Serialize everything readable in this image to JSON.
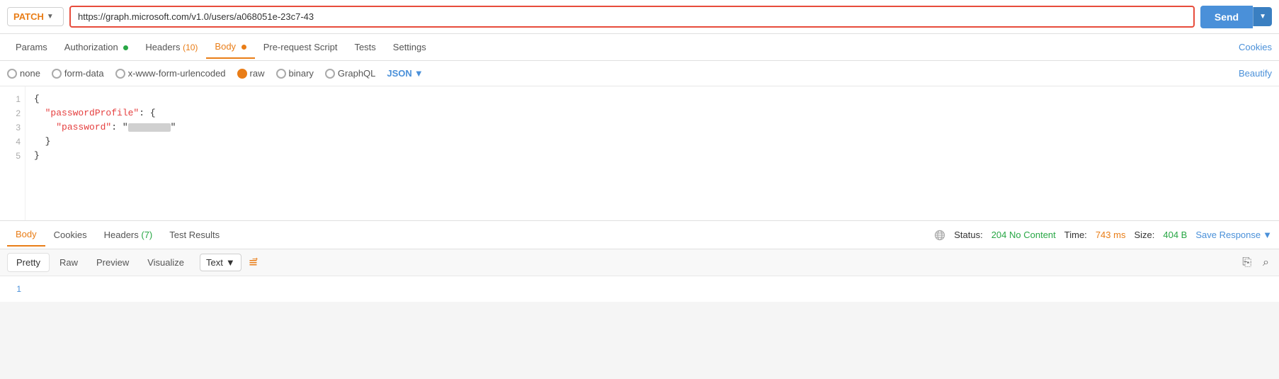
{
  "topbar": {
    "method": "PATCH",
    "url": "https://graph.microsoft.com/v1.0/users/a068051e-23c7-43",
    "send_label": "Send"
  },
  "request_tabs": [
    {
      "id": "params",
      "label": "Params",
      "active": false,
      "dot": null,
      "count": null
    },
    {
      "id": "authorization",
      "label": "Authorization",
      "active": false,
      "dot": "green",
      "count": null
    },
    {
      "id": "headers",
      "label": "Headers",
      "active": false,
      "dot": null,
      "count": "(10)"
    },
    {
      "id": "body",
      "label": "Body",
      "active": true,
      "dot": "orange",
      "count": null
    },
    {
      "id": "prerequest",
      "label": "Pre-request Script",
      "active": false,
      "dot": null,
      "count": null
    },
    {
      "id": "tests",
      "label": "Tests",
      "active": false,
      "dot": null,
      "count": null
    },
    {
      "id": "settings",
      "label": "Settings",
      "active": false,
      "dot": null,
      "count": null
    }
  ],
  "cookies_link": "Cookies",
  "body_types": [
    {
      "id": "none",
      "label": "none",
      "selected": false
    },
    {
      "id": "form-data",
      "label": "form-data",
      "selected": false
    },
    {
      "id": "x-www-form-urlencoded",
      "label": "x-www-form-urlencoded",
      "selected": false
    },
    {
      "id": "raw",
      "label": "raw",
      "selected": true
    },
    {
      "id": "binary",
      "label": "binary",
      "selected": false
    },
    {
      "id": "graphql",
      "label": "GraphQL",
      "selected": false
    }
  ],
  "json_type_label": "JSON",
  "beautify_label": "Beautify",
  "code_lines": [
    {
      "num": 1,
      "content": "{"
    },
    {
      "num": 2,
      "content": "  \"passwordProfile\": {"
    },
    {
      "num": 3,
      "content": "    \"password\": \"[REDACTED]\""
    },
    {
      "num": 4,
      "content": "  }"
    },
    {
      "num": 5,
      "content": "}"
    }
  ],
  "response_tabs": [
    {
      "id": "body",
      "label": "Body",
      "active": true
    },
    {
      "id": "cookies",
      "label": "Cookies",
      "active": false
    },
    {
      "id": "headers",
      "label": "Headers",
      "count": "(7)",
      "active": false
    },
    {
      "id": "test-results",
      "label": "Test Results",
      "active": false
    }
  ],
  "status": {
    "label": "Status:",
    "code": "204 No Content",
    "time_label": "Time:",
    "time_value": "743 ms",
    "size_label": "Size:",
    "size_value": "404 B"
  },
  "save_response_label": "Save Response",
  "format_buttons": [
    "Pretty",
    "Raw",
    "Preview",
    "Visualize"
  ],
  "active_format": "Pretty",
  "text_select_label": "Text",
  "response_line": "1"
}
